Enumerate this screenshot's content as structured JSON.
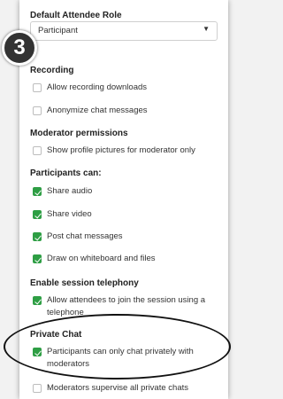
{
  "default_role": {
    "heading": "Default Attendee Role",
    "selected": "Participant",
    "arrow_icon": "caret-down-icon"
  },
  "step_badge": "3",
  "recording": {
    "heading": "Recording",
    "items": [
      {
        "label": "Allow recording downloads",
        "checked": false
      },
      {
        "label": "Anonymize chat messages",
        "checked": false
      }
    ]
  },
  "moderator_permissions": {
    "heading": "Moderator permissions",
    "items": [
      {
        "label": "Show profile pictures for moderator only",
        "checked": false
      }
    ]
  },
  "participants_can": {
    "heading": "Participants can:",
    "items": [
      {
        "label": "Share audio",
        "checked": true
      },
      {
        "label": "Share video",
        "checked": true
      },
      {
        "label": "Post chat messages",
        "checked": true
      },
      {
        "label": "Draw on whiteboard and files",
        "checked": true
      }
    ]
  },
  "session_telephony": {
    "heading": "Enable session telephony",
    "items": [
      {
        "label": "Allow attendees to join the session using a telephone",
        "checked": true
      }
    ]
  },
  "private_chat": {
    "heading": "Private Chat",
    "items": [
      {
        "label": "Participants can only chat privately with moderators",
        "checked": true
      },
      {
        "label": "Moderators supervise all private chats",
        "checked": false
      }
    ]
  },
  "colors": {
    "check_green": "#2e9e44",
    "badge": "#333333"
  }
}
